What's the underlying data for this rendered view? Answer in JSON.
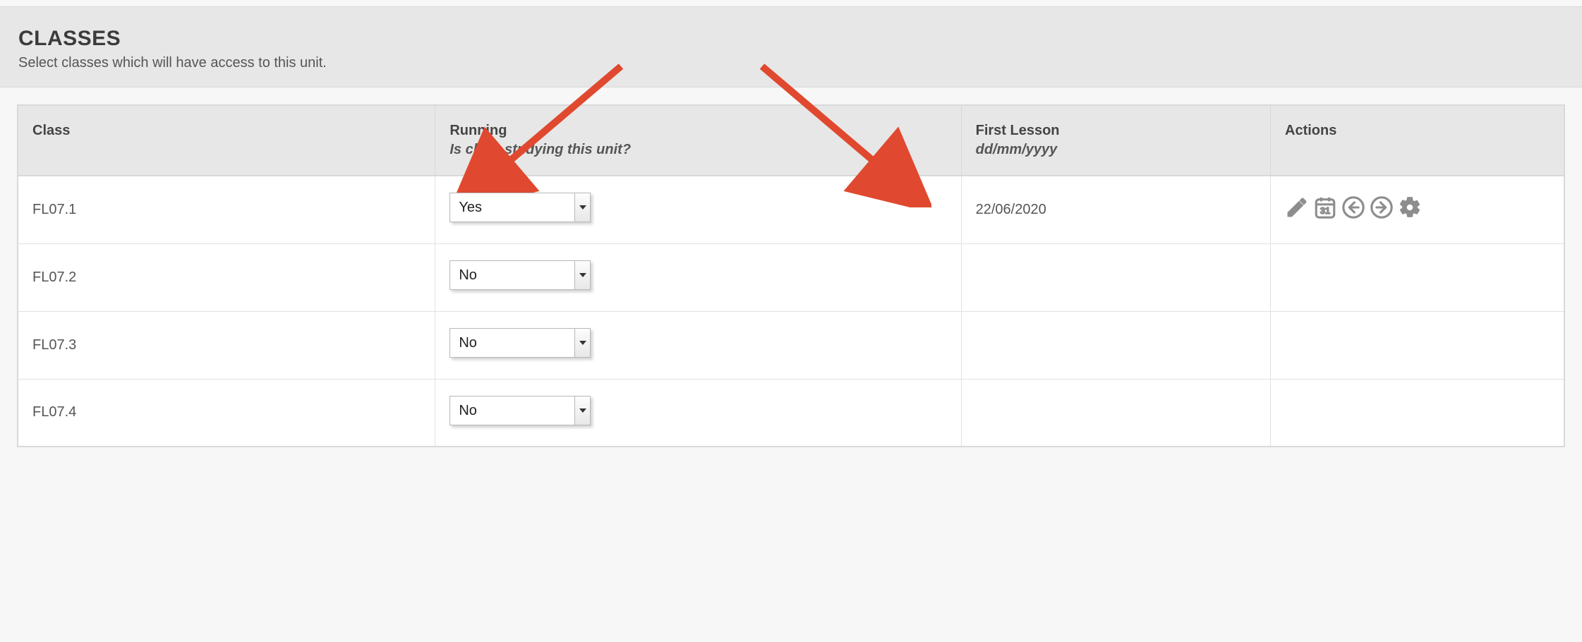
{
  "header": {
    "title": "CLASSES",
    "subtitle": "Select classes which will have access to this unit."
  },
  "table": {
    "headers": {
      "class": "Class",
      "running_main": "Running",
      "running_sub": "Is class studying this unit?",
      "first_main": "First Lesson",
      "first_sub": "dd/mm/yyyy",
      "actions": "Actions"
    },
    "rows": [
      {
        "class_name": "FL07.1",
        "running": "Yes",
        "first_lesson": "22/06/2020",
        "show_actions": true
      },
      {
        "class_name": "FL07.2",
        "running": "No",
        "first_lesson": "",
        "show_actions": false
      },
      {
        "class_name": "FL07.3",
        "running": "No",
        "first_lesson": "",
        "show_actions": false
      },
      {
        "class_name": "FL07.4",
        "running": "No",
        "first_lesson": "",
        "show_actions": false
      }
    ]
  },
  "icons": {
    "edit": "pencil-icon",
    "calendar": "calendar-icon",
    "prev": "arrow-left-circle-icon",
    "next": "arrow-right-circle-icon",
    "settings": "gear-icon"
  },
  "annotation_color": "#e0492f"
}
